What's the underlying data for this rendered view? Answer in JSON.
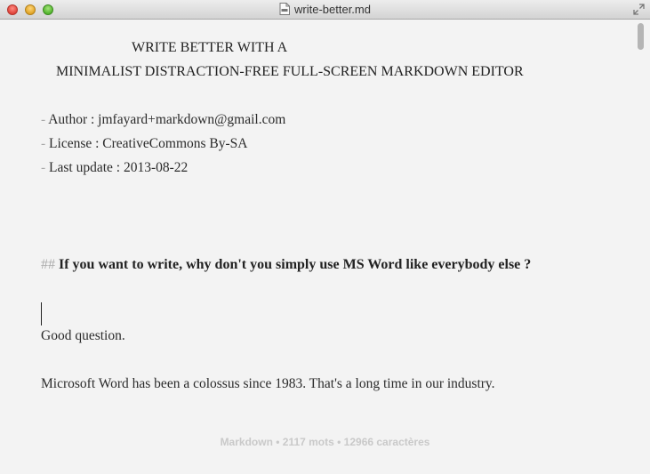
{
  "window": {
    "title": "write-better.md"
  },
  "document": {
    "header_line1": "WRITE BETTER WITH A",
    "header_line2": "MINIMALIST DISTRACTION-FREE FULL-SCREEN MARKDOWN EDITOR",
    "list_marker": "-",
    "meta": [
      "Author : jmfayard+markdown@gmail.com",
      "License : CreativeCommons By-SA",
      "Last update : 2013-08-22"
    ],
    "h2_marker": "##",
    "h2_text": "If you want to write, why don't you simply use MS Word like everybody else ?",
    "paragraph1": "Good question.",
    "paragraph2": "Microsoft Word has been a colossus since 1983. That's a long time in our industry."
  },
  "status": {
    "text": "Markdown • 2117 mots • 12966 caractères"
  },
  "icons": {
    "doc": "document-icon",
    "fullscreen": "fullscreen-icon"
  }
}
